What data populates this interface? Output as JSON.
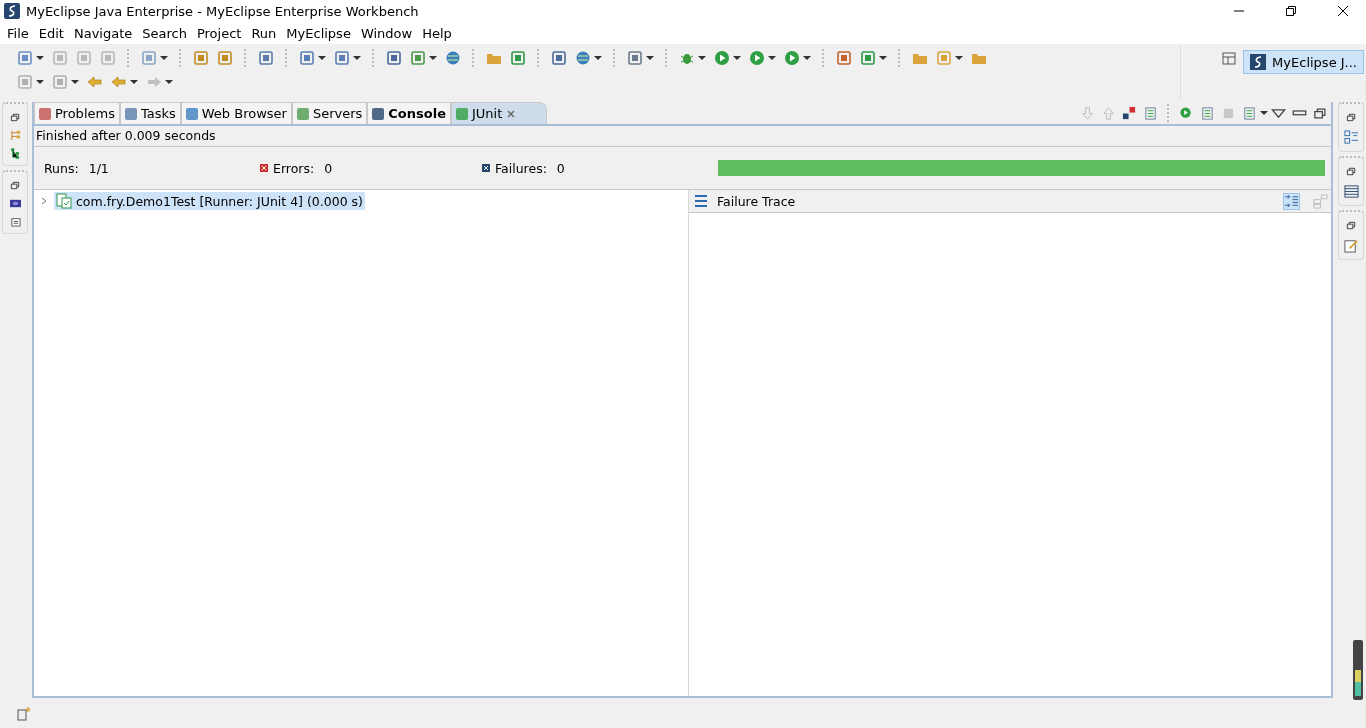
{
  "window": {
    "title": "MyEclipse Java Enterprise - MyEclipse Enterprise Workbench"
  },
  "menu": [
    "File",
    "Edit",
    "Navigate",
    "Search",
    "Project",
    "Run",
    "MyEclipse",
    "Window",
    "Help"
  ],
  "perspective": {
    "label": "MyEclipse J...",
    "selected": true
  },
  "tabs": [
    {
      "label": "Problems",
      "selected": false,
      "bold": false
    },
    {
      "label": "Tasks",
      "selected": false,
      "bold": false
    },
    {
      "label": "Web Browser",
      "selected": false,
      "bold": false
    },
    {
      "label": "Servers",
      "selected": false,
      "bold": false
    },
    {
      "label": "Console",
      "selected": false,
      "bold": true
    },
    {
      "label": "JUnit",
      "selected": true,
      "bold": false
    }
  ],
  "junit": {
    "status": "Finished after 0.009 seconds",
    "counters": [
      {
        "kind": "runs",
        "label": "Runs:",
        "value": "1/1"
      },
      {
        "kind": "errors",
        "label": "Errors:",
        "value": "0"
      },
      {
        "kind": "failures",
        "label": "Failures:",
        "value": "0"
      }
    ],
    "progress": {
      "level": 1,
      "passed": true
    },
    "tree": [
      {
        "label": "com.fry.Demo1Test [Runner: JUnit 4] (0.000 s)",
        "selected": true,
        "expanded": false
      }
    ],
    "failure_trace": {
      "title": "Failure Trace"
    }
  }
}
